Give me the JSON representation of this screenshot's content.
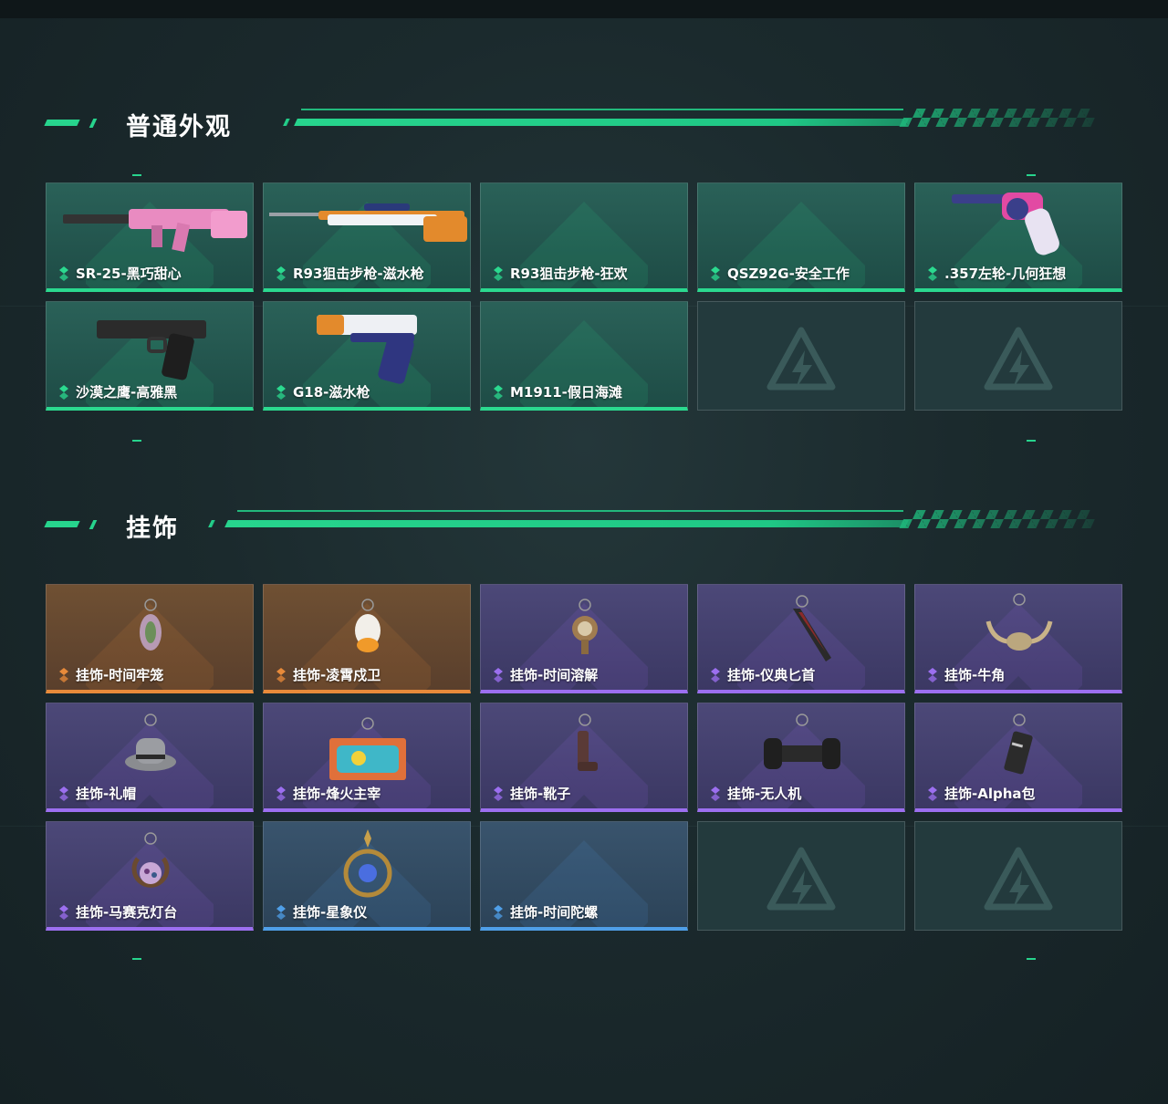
{
  "sections": [
    {
      "title": "普通外观",
      "items": [
        {
          "label": "SR-25-黑巧甜心",
          "rarity": "green",
          "icon": "rifle-pink-icon"
        },
        {
          "label": "R93狙击步枪-滋水枪",
          "rarity": "green",
          "icon": "sniper-rifle-icon"
        },
        {
          "label": "R93狙击步枪-狂欢",
          "rarity": "green",
          "icon": ""
        },
        {
          "label": "QSZ92G-安全工作",
          "rarity": "green",
          "icon": ""
        },
        {
          "label": ".357左轮-几何狂想",
          "rarity": "green",
          "icon": "revolver-icon"
        },
        {
          "label": "沙漠之鹰-高雅黑",
          "rarity": "green",
          "icon": "desert-eagle-icon"
        },
        {
          "label": "G18-滋水枪",
          "rarity": "green",
          "icon": "pistol-icon"
        },
        {
          "label": "M1911-假日海滩",
          "rarity": "green",
          "icon": ""
        }
      ],
      "empty_slots": 2
    },
    {
      "title": "挂饰",
      "items": [
        {
          "label": "挂饰-时间牢笼",
          "rarity": "orange",
          "icon": "charm-cage-icon"
        },
        {
          "label": "挂饰-凌霄戍卫",
          "rarity": "orange",
          "icon": "charm-eagle-icon"
        },
        {
          "label": "挂饰-时间溶解",
          "rarity": "purple",
          "icon": "charm-clock-icon"
        },
        {
          "label": "挂饰-仪典匕首",
          "rarity": "purple",
          "icon": "charm-dagger-icon"
        },
        {
          "label": "挂饰-牛角",
          "rarity": "purple",
          "icon": "charm-horns-icon"
        },
        {
          "label": "挂饰-礼帽",
          "rarity": "purple",
          "icon": "charm-hat-icon"
        },
        {
          "label": "挂饰-烽火主宰",
          "rarity": "purple",
          "icon": "charm-container-icon"
        },
        {
          "label": "挂饰-靴子",
          "rarity": "purple",
          "icon": "charm-boot-icon"
        },
        {
          "label": "挂饰-无人机",
          "rarity": "purple",
          "icon": "charm-drone-icon"
        },
        {
          "label": "挂饰-Alpha包",
          "rarity": "purple",
          "icon": "charm-bag-icon"
        },
        {
          "label": "挂饰-马赛克灯台",
          "rarity": "purple",
          "icon": "charm-lamp-icon"
        },
        {
          "label": "挂饰-星象仪",
          "rarity": "blue",
          "icon": "charm-astrolabe-icon"
        },
        {
          "label": "挂饰-时间陀螺",
          "rarity": "blue",
          "icon": ""
        }
      ],
      "empty_slots": 2
    }
  ],
  "colors": {
    "accent": "#27d48d",
    "green": "#2bd98f",
    "orange": "#e88a3a",
    "purple": "#9c6ff0",
    "blue": "#4f9fe8"
  }
}
